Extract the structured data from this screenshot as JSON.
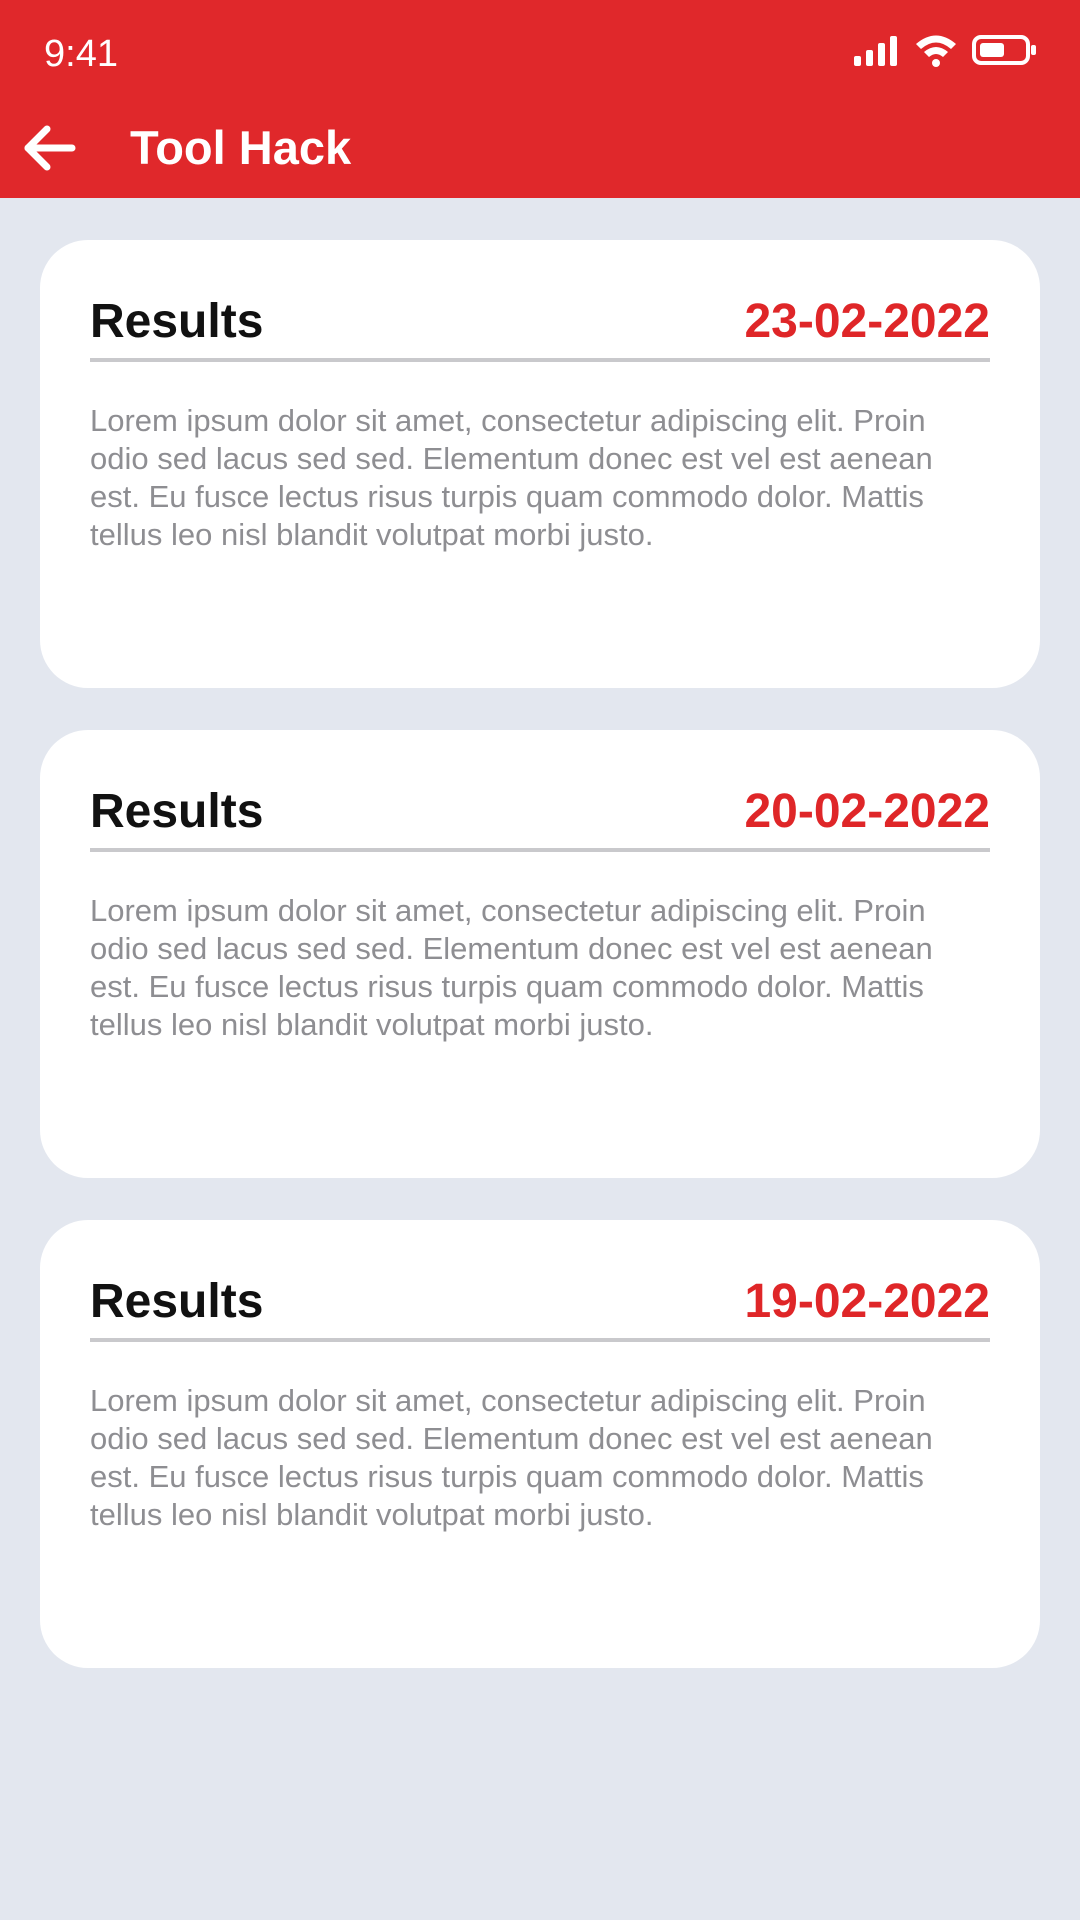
{
  "status_bar": {
    "time": "9:41",
    "icons": [
      "signal-icon",
      "wifi-icon",
      "battery-icon"
    ]
  },
  "app_bar": {
    "back_icon": "arrow-left-icon",
    "title": "Tool Hack"
  },
  "colors": {
    "header": "#e0282b",
    "accent_date": "#df2628",
    "background": "#e3e7ef"
  },
  "cards": [
    {
      "title": "Results",
      "date": "23-02-2022",
      "body": "Lorem ipsum dolor sit amet, consectetur adipiscing elit. Proin odio sed lacus sed sed. Elementum donec est vel est aenean est. Eu fusce lectus risus turpis quam commodo dolor. Mattis tellus leo nisl blandit volutpat morbi justo."
    },
    {
      "title": "Results",
      "date": "20-02-2022",
      "body": "Lorem ipsum dolor sit amet, consectetur adipiscing elit. Proin odio sed lacus sed sed. Elementum donec est vel est aenean est. Eu fusce lectus risus turpis quam commodo dolor. Mattis tellus leo nisl blandit volutpat morbi justo."
    },
    {
      "title": "Results",
      "date": "19-02-2022",
      "body": "Lorem ipsum dolor sit amet, consectetur adipiscing elit. Proin odio sed lacus sed sed. Elementum donec est vel est aenean est. Eu fusce lectus risus turpis quam commodo dolor. Mattis tellus leo nisl blandit volutpat morbi justo."
    }
  ]
}
